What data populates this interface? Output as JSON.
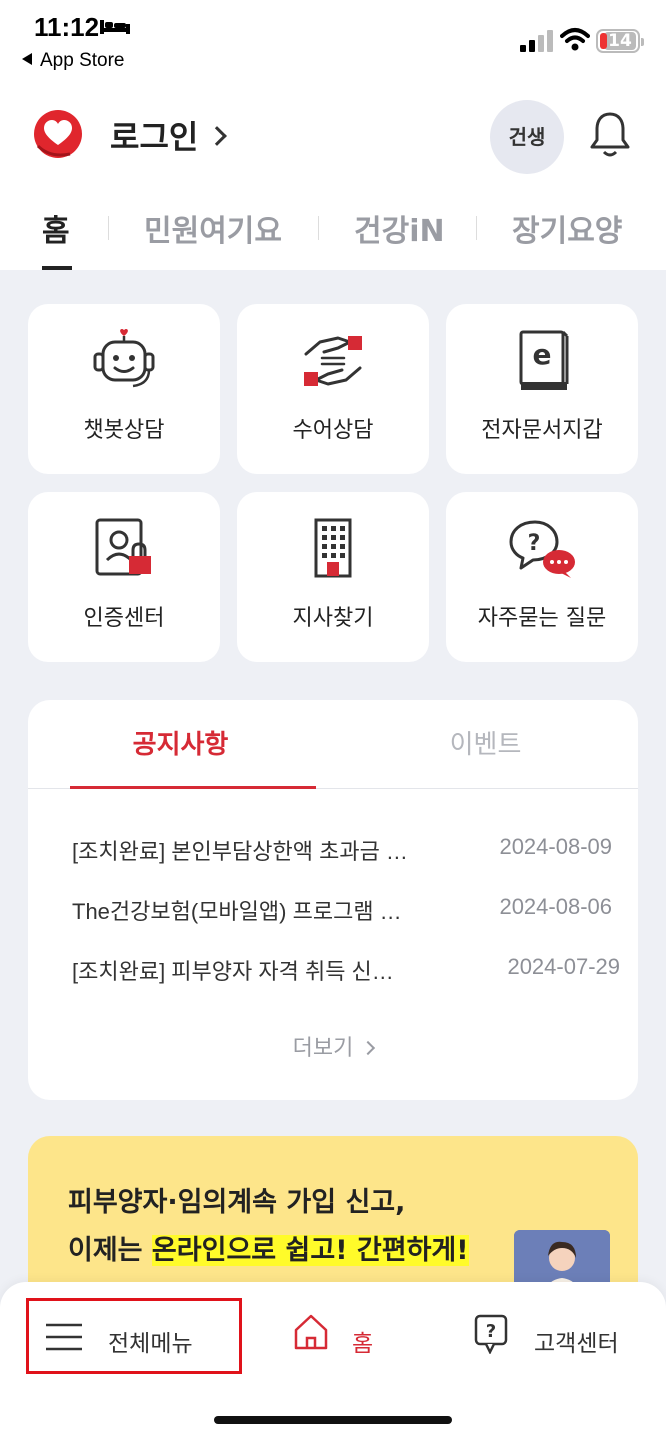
{
  "status_bar": {
    "time": "11:12",
    "back_app": "App Store",
    "battery_level": "14"
  },
  "header": {
    "login_label": "로그인",
    "profile_badge": "건생"
  },
  "tabs": [
    "홈",
    "민원여기요",
    "건강iN",
    "장기요양"
  ],
  "active_tab_index": 0,
  "quick_menu": [
    {
      "label": "챗봇상담",
      "icon": "chatbot-icon"
    },
    {
      "label": "수어상담",
      "icon": "sign-language-icon"
    },
    {
      "label": "전자문서지갑",
      "icon": "e-document-icon"
    },
    {
      "label": "인증센터",
      "icon": "certificate-lock-icon"
    },
    {
      "label": "지사찾기",
      "icon": "building-icon"
    },
    {
      "label": "자주묻는 질문",
      "icon": "faq-chat-icon"
    }
  ],
  "notice_panel": {
    "tab_notice": "공지사항",
    "tab_event": "이벤트",
    "items": [
      {
        "title": "[조치완료] 본인부담상한액 초과금 …",
        "date": "2024-08-09"
      },
      {
        "title": "The건강보험(모바일앱) 프로그램 …",
        "date": "2024-08-06"
      },
      {
        "title": "[조치완료] 피부양자 자격 취득 신…",
        "date": "2024-07-29"
      }
    ],
    "more_label": "더보기"
  },
  "banner": {
    "line1": "피부양자·임의계속 가입 신고,",
    "line2_prefix": "이제는 ",
    "line2_highlight": "온라인으로 쉽고! 간편하게!"
  },
  "bottom_nav": {
    "menu_label": "전체메뉴",
    "home_label": "홈",
    "support_label": "고객센터"
  },
  "colors": {
    "brand_red": "#d62a35",
    "banner_yellow": "#fde58a",
    "highlight": "#fffb2a",
    "background": "#eef0f5"
  }
}
